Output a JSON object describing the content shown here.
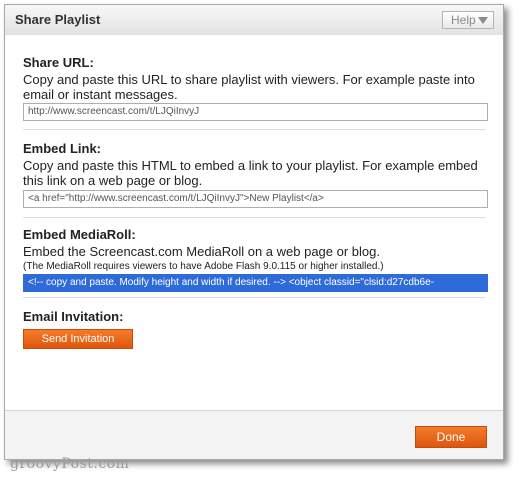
{
  "dialog": {
    "title": "Share Playlist",
    "help_label": "Help"
  },
  "share_url": {
    "label": "Share URL:",
    "description": "Copy and paste this URL to share playlist with viewers. For example paste into email or instant messages.",
    "value": "http://www.screencast.com/t/LJQiInvyJ"
  },
  "embed_link": {
    "label": "Embed Link:",
    "description": "Copy and paste this HTML to embed a link to your playlist. For example embed this link on a web page or blog.",
    "value": "<a href=\"http://www.screencast.com/t/LJQiInvyJ\">New Playlist</a>"
  },
  "embed_mediaroll": {
    "label": "Embed MediaRoll:",
    "description": "Embed the Screencast.com MediaRoll on a web page or blog.",
    "note": "(The MediaRoll requires viewers to have Adobe Flash 9.0.115 or higher installed.)",
    "value": "<!-- copy and paste.  Modify height and width if desired. --> <object classid=\"clsid:d27cdb6e-"
  },
  "email_invitation": {
    "label": "Email Invitation:",
    "button_label": "Send Invitation"
  },
  "footer": {
    "done_label": "Done"
  },
  "watermark": "groovyPost.com",
  "colors": {
    "accent_orange": "#e8661b",
    "selection_blue": "#2f6bd8"
  }
}
